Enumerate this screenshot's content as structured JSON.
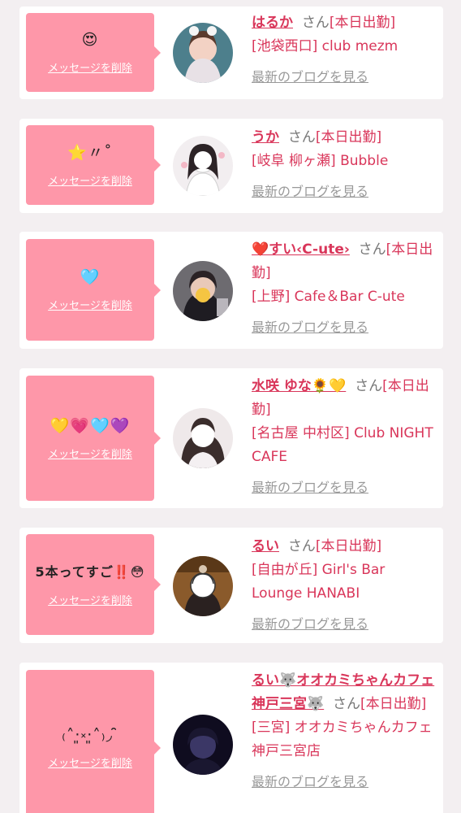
{
  "colors": {
    "accent": "#d9365a",
    "bubble": "#fe97a9",
    "background": "#f3eff1"
  },
  "delete_label": "メッセージを削除",
  "blog_label": "最新のブログを見る",
  "san_label": "さん",
  "entries": [
    {
      "message": "😍",
      "name": "はるか",
      "status": "[本日出勤]",
      "location": "[池袋西口] club mezm"
    },
    {
      "message": "⭐️〃˚",
      "name": "うか",
      "status": "[本日出勤]",
      "location": "[岐阜 柳ヶ瀬] Bubble"
    },
    {
      "message": "🩵",
      "name": "❤️すい‹C-ute›",
      "status": "[本日出勤]",
      "location": "[上野] Cafe＆Bar C-ute"
    },
    {
      "message": "💛💗🩵💜",
      "name": "水咲 ゆな🌻💛",
      "status": "[本日出勤]",
      "location": "[名古屋 中村区] Club NIGHT CAFE"
    },
    {
      "message": "5本ってすご‼️😳",
      "name": "るい",
      "status": "[本日出勤]",
      "location": "[自由が丘] Girl's Bar Lounge HANABI"
    },
    {
      "message": "₍˄·͈༝·͈˄₎◞ ̑̑",
      "name": "るい🐺オオカミちゃんカフェ神戸三宮🐺",
      "status": "[本日出勤]",
      "location": "[三宮] オオカミちゃんカフェ神戸三宮店"
    }
  ]
}
